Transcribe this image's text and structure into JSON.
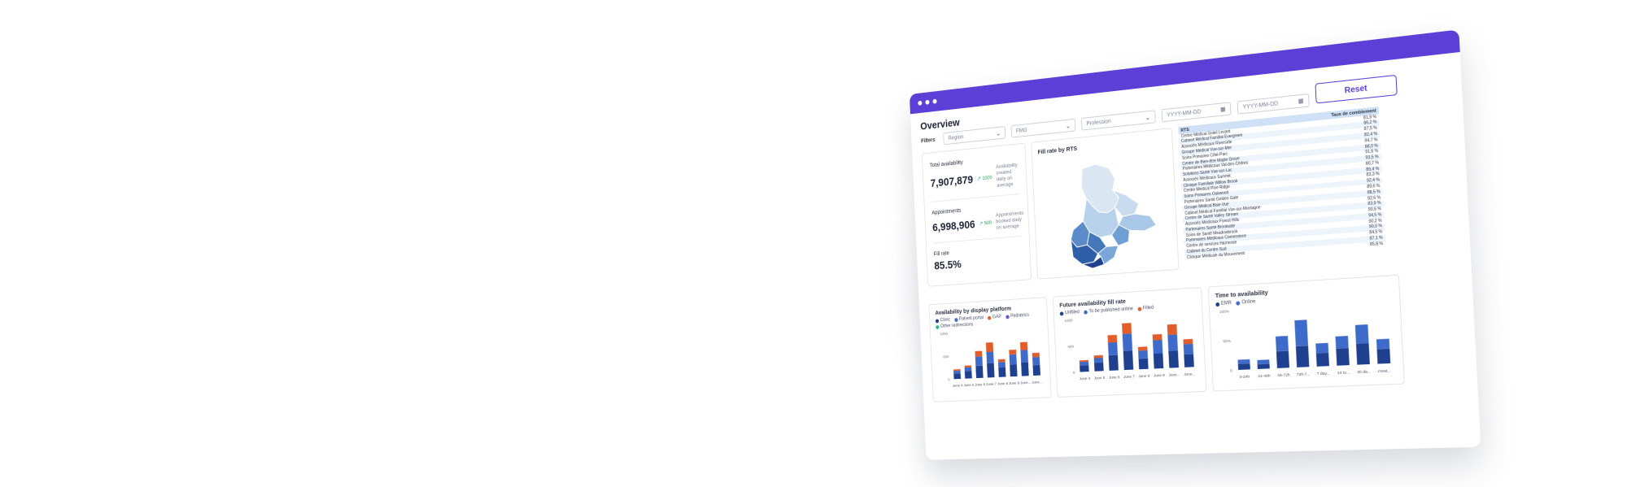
{
  "window": {
    "title": "Overview"
  },
  "filters": {
    "label": "Filters",
    "region_placeholder": "Region",
    "fmg_placeholder": "FMG",
    "profession_placeholder": "Profession",
    "date_from_placeholder": "YYYY-MM-DD",
    "date_to_placeholder": "YYYY-MM-DD",
    "reset_label": "Reset"
  },
  "kpis": {
    "availability": {
      "label": "Total availability",
      "value": "7,907,879",
      "trend": "1000",
      "note": "Availability created daily on average"
    },
    "appointments": {
      "label": "Appointments",
      "value": "6,998,906",
      "trend": "500",
      "note": "Appointments booked daily on average"
    },
    "fill_rate": {
      "label": "Fill rate",
      "value": "85.5%"
    }
  },
  "map": {
    "title": "Fill rate by RTS"
  },
  "rts_table": {
    "headers": [
      "RTS",
      "Taux de comblement"
    ],
    "rows": [
      [
        "Centre Médical Soleil Levant",
        "81,9 %"
      ],
      [
        "Cabinet Médical Familial Evergreen",
        "86,2 %"
      ],
      [
        "Associés Médicaux Riverside",
        "87,5 %"
      ],
      [
        "Groupe Médical Vue-sur-Mer",
        "82,4 %"
      ],
      [
        "Soins Primaires Côté-Parc",
        "94,7 %"
      ],
      [
        "Centre de Bien-être Maple Grove",
        "88,0 %"
      ],
      [
        "Partenaires Médicaux Val-des-Cèdres",
        "91,6 %"
      ],
      [
        "Solutions Santé Vue-sur-Lac",
        "93,5 %"
      ],
      [
        "Associés Médicaux Summit",
        "80,7 %"
      ],
      [
        "Clinique Familiale Willow Brook",
        "89,4 %"
      ],
      [
        "Centre Médical Pine Ridge",
        "83,3 %"
      ],
      [
        "Soins Primaires Oakwood",
        "92,4 %"
      ],
      [
        "Partenaires Santé Golden Gate",
        "89,6 %"
      ],
      [
        "Groupe Médical Baie-Vue",
        "88,5 %"
      ],
      [
        "Cabinet Médical Familial Vue-sur-Montagne",
        "92,6 %"
      ],
      [
        "Centre de Santé Valley Stream",
        "83,9 %"
      ],
      [
        "Associés Médicaux Forest Hills",
        "93,6 %"
      ],
      [
        "Partenaires Santé Brookside",
        "94,5 %"
      ],
      [
        "Soins de Santé Meadowbrook",
        "90,2 %"
      ],
      [
        "Partenaires Médicaux Cornerstone",
        "90,0 %"
      ],
      [
        "Centre de services Harmonie",
        "84,5 %"
      ],
      [
        "Cabinet du Centre-Sud",
        "87,1 %"
      ],
      [
        "Clinique Médicale du Mouvement",
        "85,8 %"
      ]
    ]
  },
  "chart_data": [
    {
      "type": "bar",
      "title": "Availability by display platform",
      "categories": [
        "June 4",
        "June 5",
        "June 6",
        "June 7",
        "June 8",
        "June 9",
        "June...",
        "June..."
      ],
      "ylim": [
        0,
        1000
      ],
      "yticks": [
        "1000",
        "500",
        "0"
      ],
      "stacked": true,
      "series": [
        {
          "name": "Clinic",
          "color": "#1f3f8f",
          "values": [
            120,
            160,
            260,
            300,
            200,
            250,
            290,
            220
          ]
        },
        {
          "name": "Patient portal",
          "color": "#3e6bc9",
          "values": [
            60,
            80,
            200,
            250,
            120,
            220,
            260,
            170
          ]
        },
        {
          "name": "GAP",
          "color": "#e35d2a",
          "values": [
            30,
            40,
            120,
            200,
            60,
            100,
            170,
            90
          ]
        },
        {
          "name": "Pediatrics",
          "color": "#6f4fd8",
          "values": [
            0,
            0,
            0,
            0,
            0,
            0,
            0,
            0
          ]
        },
        {
          "name": "Other redirections",
          "color": "#2bb7a8",
          "values": [
            0,
            0,
            0,
            0,
            0,
            0,
            0,
            0
          ]
        }
      ]
    },
    {
      "type": "bar",
      "title": "Future availability fill rate",
      "categories": [
        "June 4",
        "June 5",
        "June 6",
        "June 7",
        "June 8",
        "June 9",
        "June...",
        "June..."
      ],
      "ylim": [
        0,
        1000
      ],
      "yticks": [
        "1000",
        "500",
        "0"
      ],
      "stacked": true,
      "series": [
        {
          "name": "Unfilled",
          "color": "#1f3f8f",
          "values": [
            120,
            160,
            290,
            360,
            200,
            280,
            320,
            240
          ]
        },
        {
          "name": "To be published online",
          "color": "#3e6bc9",
          "values": [
            70,
            90,
            240,
            320,
            150,
            250,
            300,
            190
          ]
        },
        {
          "name": "Filled",
          "color": "#e35d2a",
          "values": [
            30,
            50,
            140,
            200,
            70,
            110,
            190,
            90
          ]
        }
      ]
    },
    {
      "type": "bar",
      "title": "Time to availability",
      "categories": [
        "0-24h",
        "24-48h",
        "48-72h",
        "72h-7...",
        "7 day...",
        "14 to...",
        "30 da...",
        "creat..."
      ],
      "ylim": [
        0,
        100
      ],
      "yticks": [
        "100%",
        "50%",
        "0"
      ],
      "stacked": true,
      "series": [
        {
          "name": "EMR",
          "color": "#1f3f8f",
          "values": [
            10,
            8,
            28,
            35,
            22,
            28,
            34,
            24
          ]
        },
        {
          "name": "Online",
          "color": "#3e6bc9",
          "values": [
            7,
            7,
            25,
            43,
            16,
            20,
            31,
            16
          ]
        }
      ]
    }
  ]
}
